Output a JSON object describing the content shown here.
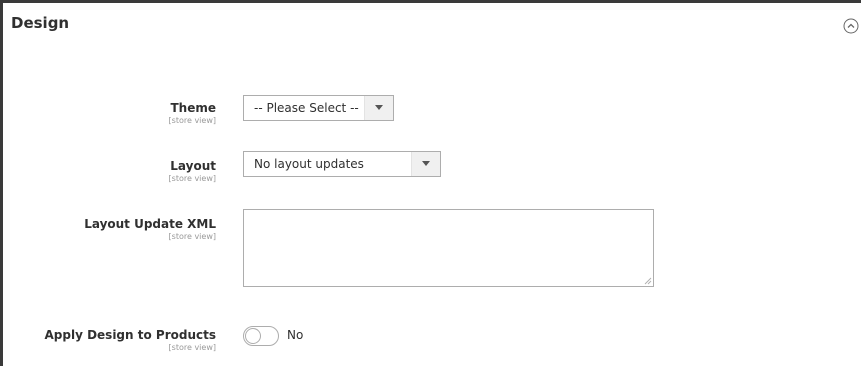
{
  "section": {
    "title": "Design",
    "collapse_icon": "chevron-up-circle-icon"
  },
  "fields": {
    "theme": {
      "label": "Theme",
      "scope": "[store view]",
      "value": "-- Please Select --",
      "arrow_icon": "caret-down-icon"
    },
    "layout": {
      "label": "Layout",
      "scope": "[store view]",
      "value": "No layout updates",
      "arrow_icon": "caret-down-icon"
    },
    "layout_update_xml": {
      "label": "Layout Update XML",
      "scope": "[store view]",
      "value": ""
    },
    "apply_design_to_products": {
      "label": "Apply Design to Products",
      "scope": "[store view]",
      "state": "No",
      "checked": false
    }
  }
}
